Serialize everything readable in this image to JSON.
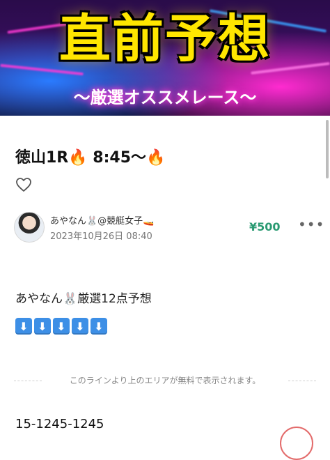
{
  "banner": {
    "title": "直前予想",
    "subtitle": "〜厳選オススメレース〜"
  },
  "article": {
    "title": "徳山1R🔥 8:45〜🔥",
    "author_name": "あやなん🐰@競艇女子🚤",
    "post_date": "2023年10月26日 08:40",
    "price": "¥500",
    "more_label": "•••",
    "body_line1": "あやなん🐰厳選12点予想",
    "arrows": [
      "⬇",
      "⬇",
      "⬇",
      "⬇",
      "⬇"
    ],
    "free_area_notice": "このラインより上のエリアが無料で表示されます。",
    "ticket_line": "15-1245-1245"
  },
  "icons": {
    "like": "heart-outline-icon",
    "more": "more-dots-icon"
  },
  "colors": {
    "price": "#2a9a72",
    "banner_title": "#ffe600",
    "arrow_bg": "#3d8fe6"
  }
}
